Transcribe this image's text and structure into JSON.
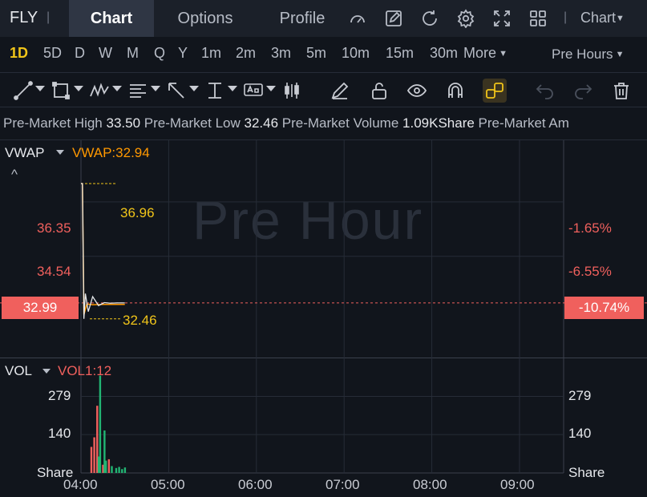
{
  "header": {
    "ticker": "FLY",
    "separator": "|",
    "tabs": [
      "Chart",
      "Options",
      "Profile"
    ],
    "chart_menu": "Chart"
  },
  "periods": {
    "items": [
      "1D",
      "5D",
      "D",
      "W",
      "M",
      "Q",
      "Y",
      "1m",
      "2m",
      "3m",
      "5m",
      "10m",
      "15m",
      "30m"
    ],
    "active": "1D",
    "more_label": "More",
    "session_label": "Pre Hours"
  },
  "info": {
    "high_label": "Pre-Market High",
    "high_value": "33.50",
    "low_label": "Pre-Market Low",
    "low_value": "32.46",
    "volume_label": "Pre-Market Volume",
    "volume_value": "1.09KShare",
    "amount_label": "Pre-Market Am"
  },
  "main_pane": {
    "indicator": "VWAP",
    "indicator_value": "VWAP:32.94",
    "watermark": "Pre Hour",
    "left_ticks": [
      "36.35",
      "34.54"
    ],
    "right_ticks": [
      "-1.65%",
      "-6.55%"
    ],
    "current_price": "32.99",
    "current_change": "-10.74%",
    "high_marker": "36.96",
    "low_marker": "32.46"
  },
  "vol_pane": {
    "indicator": "VOL",
    "indicator_value": "VOL1:12",
    "left_ticks": [
      "279",
      "140",
      "Share"
    ],
    "right_ticks": [
      "279",
      "140",
      "Share"
    ]
  },
  "time_axis": [
    "04:00",
    "05:00",
    "06:00",
    "07:00",
    "08:00",
    "09:00"
  ],
  "colors": {
    "up": "#22b573",
    "down": "#f0605d",
    "accent": "#f0c419",
    "vwap": "#ff9800",
    "background": "#11151c"
  },
  "chart_data": {
    "type": "line",
    "price": {
      "x": [
        "04:00",
        "04:01",
        "04:02",
        "04:03",
        "04:05",
        "04:08",
        "04:12",
        "04:16",
        "04:20",
        "04:25",
        "04:30"
      ],
      "y": [
        36.96,
        36.96,
        32.46,
        33.3,
        32.7,
        33.2,
        32.9,
        33.0,
        32.98,
        32.99,
        32.99
      ]
    },
    "vwap": {
      "x": [
        "04:00",
        "04:01",
        "04:02",
        "04:04",
        "04:08",
        "04:15",
        "04:30"
      ],
      "y": [
        36.96,
        36.96,
        32.6,
        32.95,
        32.93,
        32.94,
        32.94
      ]
    },
    "volume": [
      {
        "x": "04:07",
        "v": 95,
        "dir": "down"
      },
      {
        "x": "04:09",
        "v": 130,
        "dir": "down"
      },
      {
        "x": "04:11",
        "v": 245,
        "dir": "down"
      },
      {
        "x": "04:12",
        "v": 60,
        "dir": "up"
      },
      {
        "x": "04:13",
        "v": 355,
        "dir": "up"
      },
      {
        "x": "04:15",
        "v": 30,
        "dir": "down"
      },
      {
        "x": "04:16",
        "v": 155,
        "dir": "up"
      },
      {
        "x": "04:17",
        "v": 45,
        "dir": "up"
      },
      {
        "x": "04:19",
        "v": 50,
        "dir": "down"
      },
      {
        "x": "04:21",
        "v": 25,
        "dir": "up"
      },
      {
        "x": "04:24",
        "v": 18,
        "dir": "up"
      },
      {
        "x": "04:26",
        "v": 22,
        "dir": "up"
      },
      {
        "x": "04:28",
        "v": 14,
        "dir": "up"
      },
      {
        "x": "04:30",
        "v": 20,
        "dir": "up"
      }
    ],
    "price_ylim": [
      31.2,
      38.4
    ],
    "volume_ylim": [
      0,
      418
    ],
    "x_range": [
      "04:00",
      "09:30"
    ],
    "grid": true
  }
}
